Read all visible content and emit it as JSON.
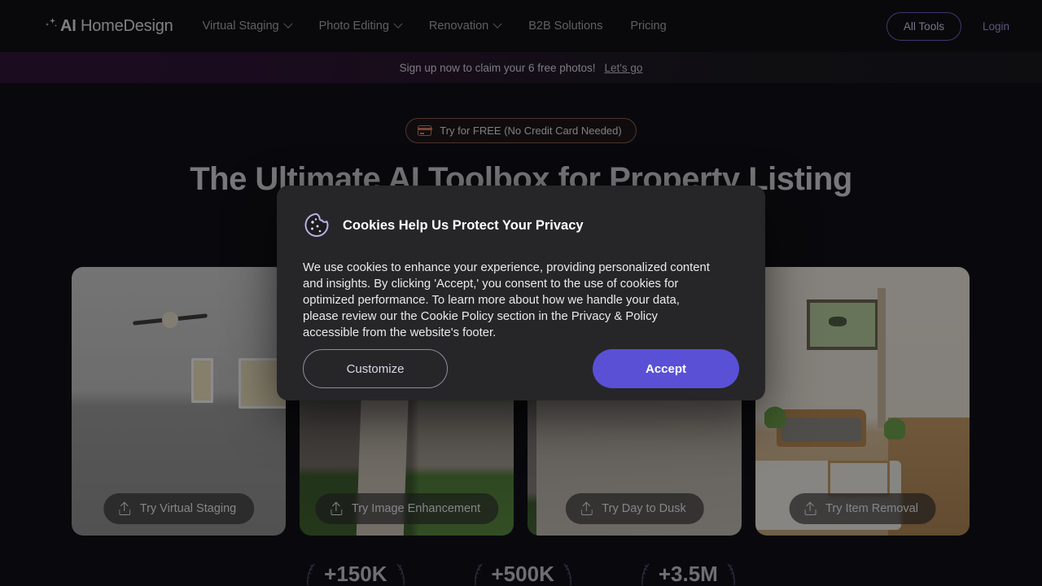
{
  "brand": {
    "name_light": "AI",
    "name_rest": " HomeDesign",
    "spark_icon": "sparkle-icon"
  },
  "nav": {
    "links": [
      {
        "label": "Virtual Staging",
        "has_chevron": true
      },
      {
        "label": "Photo Editing",
        "has_chevron": true
      },
      {
        "label": "Renovation",
        "has_chevron": true
      },
      {
        "label": "B2B Solutions",
        "has_chevron": false
      },
      {
        "label": "Pricing",
        "has_chevron": false
      }
    ],
    "all_tools": "All Tools",
    "login": "Login"
  },
  "announcement": {
    "text": "Sign up now to claim your 6 free photos!",
    "link": "Let's go"
  },
  "hero": {
    "badge": "Try for FREE (No Credit Card Needed)",
    "badge_icon": "credit-card-icon",
    "headline": "The Ultimate AI Toolbox for Property Listing",
    "subline": ""
  },
  "cards": [
    {
      "name": "virtual-staging",
      "button": "Try Virtual Staging",
      "icon": "upload-icon"
    },
    {
      "name": "image-enhancement",
      "button": "Try Image Enhancement",
      "icon": "upload-icon"
    },
    {
      "name": "day-to-dusk",
      "button": "Try Day to Dusk",
      "icon": "upload-icon"
    },
    {
      "name": "item-removal",
      "button": "Try Item Removal",
      "icon": "upload-icon"
    }
  ],
  "stats": [
    {
      "value": "+150K"
    },
    {
      "value": "+500K"
    },
    {
      "value": "+3.5M"
    }
  ],
  "cookie_modal": {
    "icon": "cookie-icon",
    "title": "Cookies Help Us Protect Your Privacy",
    "body": "We use cookies to enhance your experience, providing personalized content and insights. By clicking 'Accept,' you consent to the use of cookies for optimized performance. To learn more about how we handle your data, please review our the Cookie Policy section in the Privacy & Policy accessible from the website's footer.",
    "customize_label": "Customize",
    "accept_label": "Accept"
  },
  "colors": {
    "page_bg": "#0b0b0f",
    "accent_purple": "#5a50d6",
    "badge_orange": "#d4795c",
    "modal_bg": "#262628",
    "login_purple": "#9e97e4"
  }
}
